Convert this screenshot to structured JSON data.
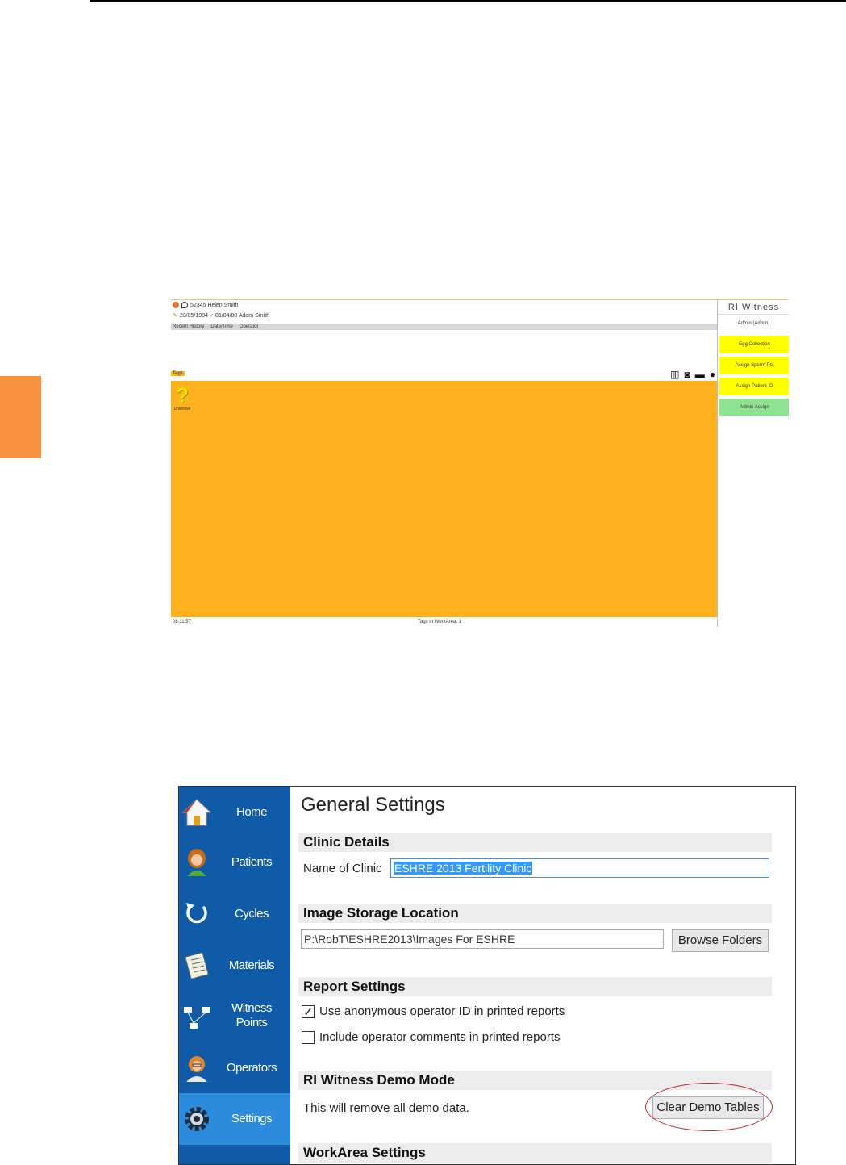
{
  "workarea_screen": {
    "patient_line": "52345 Helen Smith",
    "partner_line": "23/05/1984 ♂ 01/04/88 Adam Smith",
    "tabs": [
      "Recent History",
      "Date/Time",
      "Operator"
    ],
    "tags_label": "Tags",
    "unknown_label": "Unknown",
    "status_left": "08:11:57",
    "status_center": "Tags in WorkArea: 1",
    "brand": "RI Witness",
    "operator": "Admin (Admin)",
    "buttons": [
      "Egg Collection",
      "Assign Sperm Pot",
      "Assign Patient ID",
      "Admin Assign"
    ],
    "colors": {
      "workarea": "#fdb21e",
      "button_yellow": "#ffff00",
      "button_green": "#8fe28f"
    }
  },
  "settings_screen": {
    "nav": {
      "items": [
        {
          "label": "Home",
          "icon": "home-icon"
        },
        {
          "label": "Patients",
          "icon": "patient-icon"
        },
        {
          "label": "Cycles",
          "icon": "cycle-arrow-icon"
        },
        {
          "label": "Materials",
          "icon": "materials-icon"
        },
        {
          "label": "Witness Points",
          "icon": "witness-points-icon"
        },
        {
          "label": "Operators",
          "icon": "operator-icon"
        },
        {
          "label": "Settings",
          "icon": "gear-icon",
          "active": true
        }
      ],
      "colors": {
        "background": "#0f5ba7",
        "active": "#2c8bdc"
      }
    },
    "title": "General Settings",
    "clinic": {
      "header": "Clinic Details",
      "name_label": "Name of Clinic",
      "name_value": "ESHRE 2013 Fertility Clinic"
    },
    "storage": {
      "header": "Image Storage Location",
      "path_value": "P:\\RobT\\ESHRE2013\\Images For ESHRE",
      "browse_label": "Browse Folders"
    },
    "report": {
      "header": "Report Settings",
      "option1": {
        "label": "Use anonymous operator ID in printed reports",
        "checked": true
      },
      "option2": {
        "label": "Include operator comments in printed reports",
        "checked": false
      }
    },
    "demo": {
      "header": "RI Witness Demo Mode",
      "text": "This will remove all demo data.",
      "button_label": "Clear Demo Tables"
    },
    "workarea": {
      "header": "WorkArea Settings"
    }
  }
}
